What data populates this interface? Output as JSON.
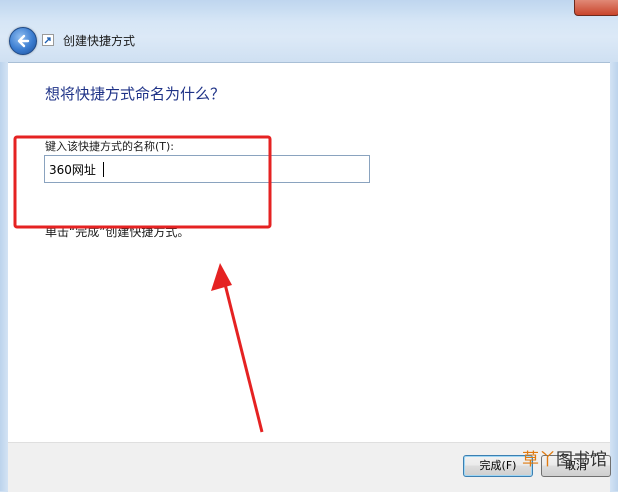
{
  "window": {
    "title": "创建快捷方式",
    "icons": {
      "back": "back-arrow-icon",
      "title": "shortcut-icon",
      "close": "close-icon"
    }
  },
  "content": {
    "heading": "想将快捷方式命名为什么？",
    "field_label": "键入该快捷方式的名称(T):",
    "name_value": "360网址",
    "hint": "单击“完成”创建快捷方式。"
  },
  "footer": {
    "finish_label": "完成(F)",
    "cancel_label": "取消"
  },
  "annotation": {
    "highlight_color": "#e52222",
    "arrow_color": "#e52222"
  },
  "watermark": {
    "part_a": "草丫",
    "part_b": "图书馆"
  }
}
